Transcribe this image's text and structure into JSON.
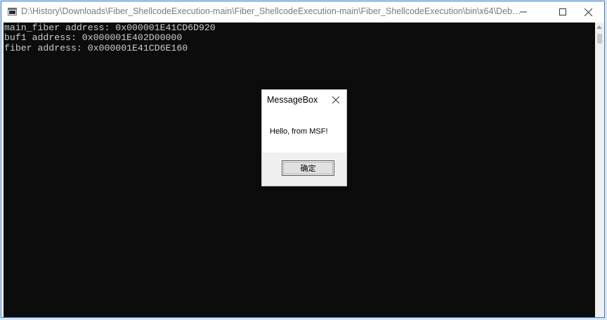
{
  "window": {
    "title": "D:\\History\\Downloads\\Fiber_ShellcodeExecution-main\\Fiber_ShellcodeExecution-main\\Fiber_ShellcodeExecution\\bin\\x64\\Debug\\Fiber_Shel...",
    "icon": "console-app-icon",
    "controls": [
      "minimize-icon",
      "maximize-icon",
      "close-icon"
    ]
  },
  "console": {
    "lines": [
      "main_fiber address: 0x000001E41CD6D920",
      "buf1 address: 0x000001E402D00000",
      "fiber address: 0x000001E41CD6E160"
    ],
    "background": "#0c0c0c",
    "foreground": "#cccccc"
  },
  "messagebox": {
    "title": "MessageBox",
    "message": "Hello, from MSF!",
    "ok_label": "确定"
  },
  "colors": {
    "window_border": "#3a7bd5",
    "dialog_footer": "#f0f0f0"
  }
}
